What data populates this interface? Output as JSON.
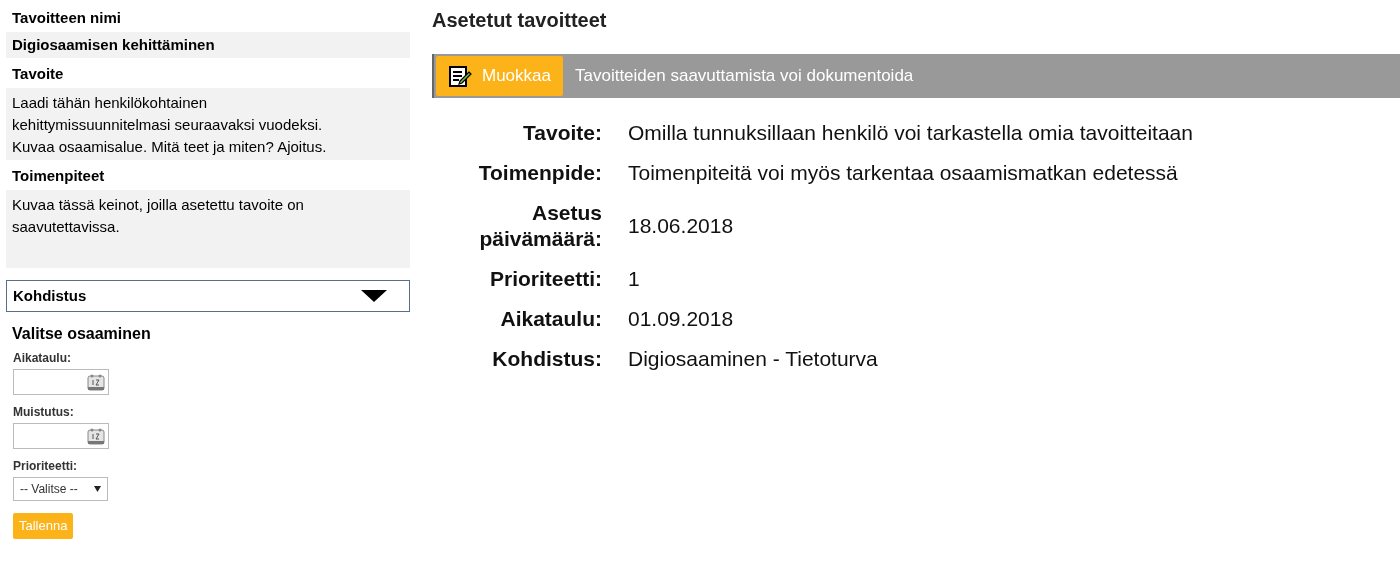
{
  "form": {
    "fields": [
      {
        "label": "Tavoitteen nimi",
        "value": "Digiosaamisen kehittäminen",
        "kind": "title"
      },
      {
        "label": "Tavoite",
        "value": "Laadi tähän henkilökohtainen kehittymissuunnitelmasi seuraavaksi vuodeksi. Kuvaa osaamisalue. Mitä teet ja miten? Ajoitus.",
        "kind": "text"
      },
      {
        "label": "Toimenpiteet",
        "value": "Kuvaa tässä keinot, joilla asetettu tavoite on saavutettavissa.",
        "kind": "text"
      }
    ],
    "dropdown": {
      "label": "Kohdistus"
    },
    "subheading": "Valitse osaaminen",
    "date_fields": [
      {
        "label": "Aikataulu:"
      },
      {
        "label": "Muistutus:"
      }
    ],
    "priority": {
      "label": "Prioriteetti:",
      "value": "-- Valitse --"
    },
    "save_button": "Tallenna"
  },
  "goals": {
    "title": "Asetetut tavoitteet",
    "toolbar": {
      "button": "Muokkaa",
      "hint": "Tavoitteiden saavuttamista voi dokumentoida"
    },
    "details": [
      {
        "label": "Tavoite:",
        "value": "Omilla tunnuksillaan henkilö voi tarkastella omia tavoitteitaan"
      },
      {
        "label": "Toimenpide:",
        "value": "Toimenpiteitä voi myös tarkentaa osaamismatkan edetessä"
      },
      {
        "label": "Asetus päivämäärä:",
        "value": "18.06.2018"
      },
      {
        "label": "Prioriteetti:",
        "value": "1"
      },
      {
        "label": "Aikataulu:",
        "value": "01.09.2018"
      },
      {
        "label": "Kohdistus:",
        "value": "Digiosaaminen - Tietoturva"
      }
    ]
  }
}
